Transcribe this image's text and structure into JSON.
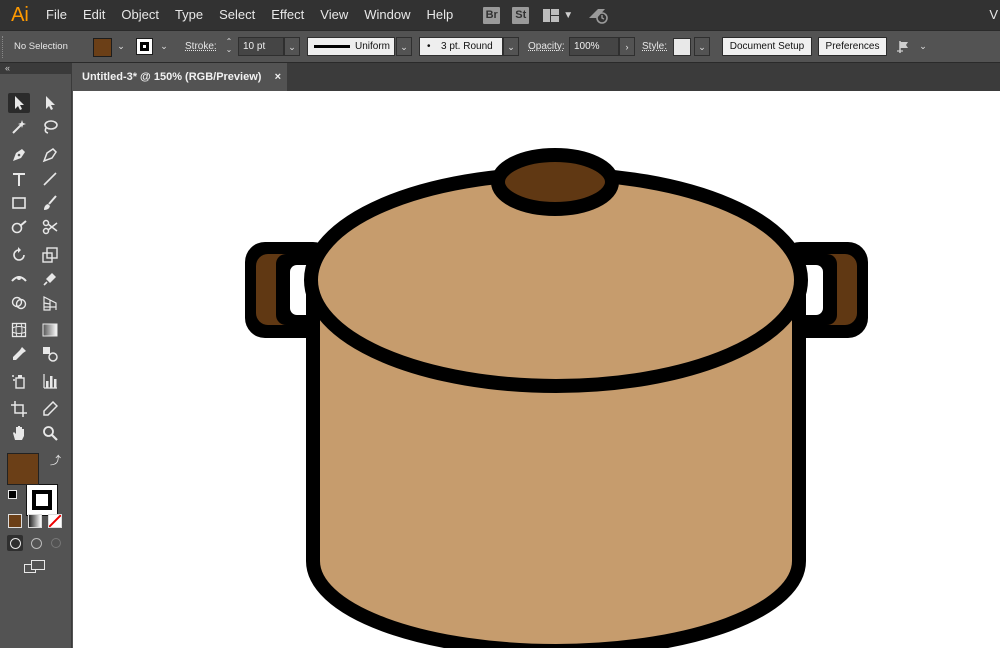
{
  "app": {
    "logo": "Ai"
  },
  "menu": [
    "File",
    "Edit",
    "Object",
    "Type",
    "Select",
    "Effect",
    "View",
    "Window",
    "Help"
  ],
  "bridge_buttons": [
    "Br",
    "St"
  ],
  "menubar_right_text": "V",
  "control_bar": {
    "selection": "No Selection",
    "fill_color": "#6b3f17",
    "stroke_label": "Stroke:",
    "stroke_weight": "10 pt",
    "profile": "Uniform",
    "brush_dot": "•",
    "brush": "3 pt. Round",
    "opacity_label": "Opacity:",
    "opacity": "100%",
    "style_label": "Style:",
    "document_setup": "Document Setup",
    "preferences": "Preferences"
  },
  "toolbox": {
    "collapse": "«",
    "fill_color": "#6b3f17",
    "stroke_color": "#000000"
  },
  "document": {
    "tab_title": "Untitled-3* @ 150% (RGB/Preview)",
    "close": "×"
  },
  "artwork": {
    "subject": "cooking pot illustration",
    "colors": {
      "body": "#c69c6d",
      "handle": "#603813",
      "knob": "#603813",
      "outline": "#000000"
    }
  }
}
